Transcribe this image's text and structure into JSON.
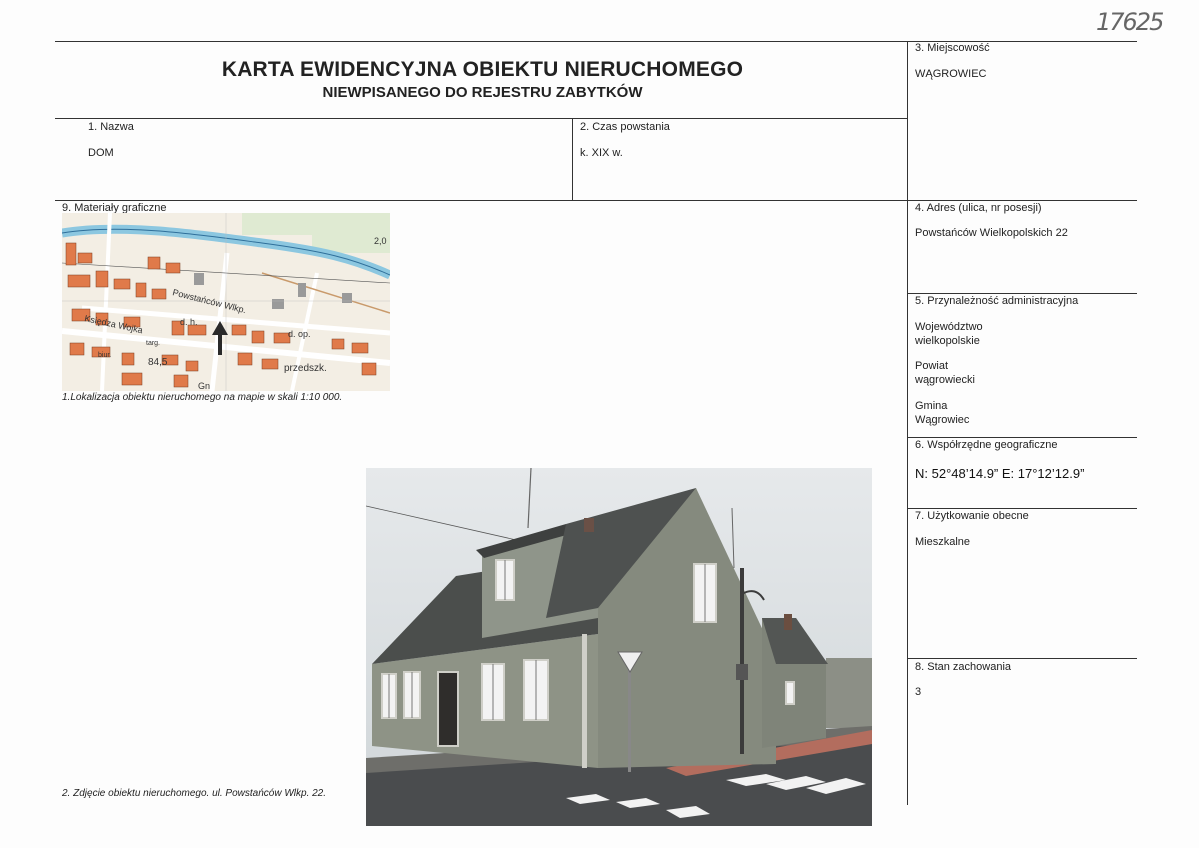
{
  "document": {
    "handwritten_number": "17625",
    "title_line1": "KARTA EWIDENCYJNA OBIEKTU NIERUCHOMEGO",
    "title_line2": "NIEWPISANEGO DO REJESTRU ZABYTKÓW"
  },
  "fields": {
    "nazwa": {
      "label": "1.    Nazwa",
      "value": "DOM"
    },
    "czas": {
      "label": "2. Czas powstania",
      "value": "k. XIX w."
    },
    "miejscowosc": {
      "label": "3. Miejscowość",
      "value": "WĄGROWIEC"
    },
    "adres": {
      "label": "4. Adres (ulica, nr posesji)",
      "value": "Powstańców Wielkopolskich 22"
    },
    "przynaleznosc": {
      "label": "5. Przynależność administracyjna",
      "wojewodztwo_label": "Województwo",
      "wojewodztwo": "wielkopolskie",
      "powiat_label": "Powiat",
      "powiat": "wągrowiecki",
      "gmina_label": "Gmina",
      "gmina": "Wągrowiec"
    },
    "wspolrzedne": {
      "label": "6. Współrzędne geograficzne",
      "value": "N: 52°48’14.9”  E: 17°12’12.9”"
    },
    "uzytkowanie": {
      "label": "7. Użytkowanie obecne",
      "value": "Mieszkalne"
    },
    "stan": {
      "label": "8. Stan zachowania",
      "value": "3"
    },
    "materialy": {
      "label": "9. Materiały graficzne"
    }
  },
  "map": {
    "caption": "1.Lokalizacja obiektu nieruchomego na mapie w skali 1:10 000.",
    "labels": {
      "street1": "Powstańców Wlkp.",
      "street2": "Księdza Wojka",
      "dh": "d. h.",
      "dop": "d. op.",
      "num": "84,5",
      "przedszk": "przedszk.",
      "elev": "2,0",
      "targ": "targ.",
      "biur": "biur.",
      "gn": "Gn"
    }
  },
  "photo": {
    "caption": "2. Zdjęcie obiektu nieruchomego. ul. Powstańców Wlkp. 22."
  },
  "colors": {
    "line": "#333333",
    "map_building": "#e07a4a",
    "map_river": "#9fd0e6",
    "map_road": "#ffffff",
    "sky": "#dde1e4",
    "roof": "#4b4e4c",
    "wall": "#8f9488"
  }
}
